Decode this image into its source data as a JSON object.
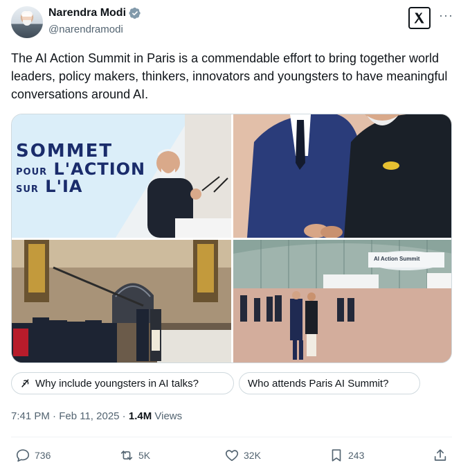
{
  "author": {
    "display_name": "Narendra Modi",
    "handle": "@narendramodi",
    "verified_icon": "verified-badge-icon",
    "avatar_icon": "avatar"
  },
  "header": {
    "x_logo_icon": "x-logo-icon",
    "more_label": "···"
  },
  "tweet": {
    "text": "The AI Action Summit in Paris is a commendable effort to bring together world leaders, policy makers, thinkers, innovators and youngsters to have meaningful conversations around AI."
  },
  "photos": {
    "p1_sign": {
      "line1": "SOMMET",
      "line2_small": "POUR",
      "line2": "L'ACTION",
      "line3_small": "SUR",
      "line3": "L'IA"
    },
    "p4_sign": "AI Action Summit"
  },
  "suggestions": [
    {
      "label": "Why include youngsters in AI talks?",
      "icon": "grok-icon"
    },
    {
      "label": "Who attends Paris AI Summit?"
    }
  ],
  "meta": {
    "time": "7:41 PM",
    "separator": " · ",
    "date": "Feb 11, 2025",
    "views_count": "1.4M",
    "views_label": " Views"
  },
  "actions": {
    "reply_count": "736",
    "retweet_count": "5K",
    "like_count": "32K",
    "bookmark_count": "243"
  },
  "colors": {
    "text_primary": "#0f1419",
    "text_secondary": "#536471",
    "border": "#cfd9de",
    "verified": "#829aab"
  }
}
